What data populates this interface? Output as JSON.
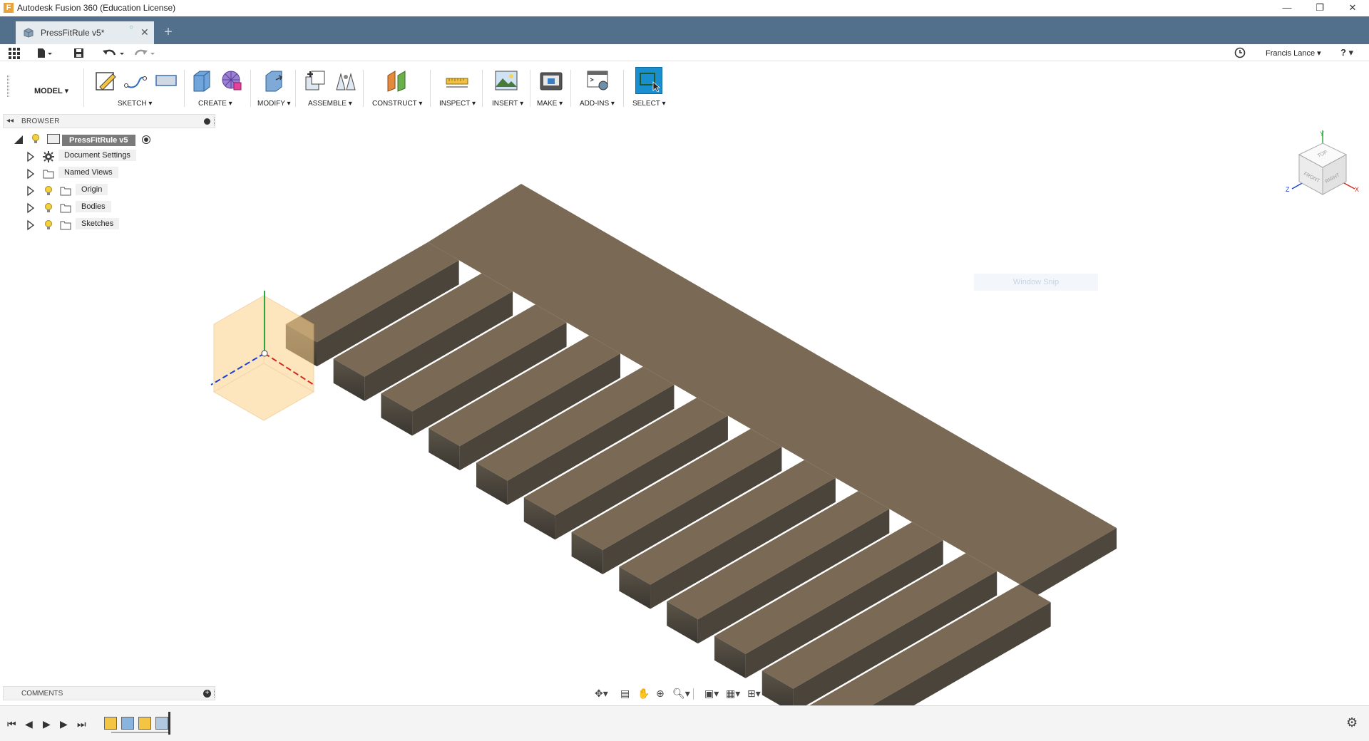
{
  "app": {
    "title": "Autodesk Fusion 360 (Education License)",
    "logo_letter": "F",
    "window_controls": {
      "minimize": "—",
      "restore": "❐",
      "close": "✕"
    }
  },
  "tab": {
    "label": "PressFitRule v5*",
    "close": "✕",
    "new_tab": "+"
  },
  "quickaccess": {
    "user": "Francis Lance ▾",
    "help": "? ▾"
  },
  "toolbar": {
    "workspace": "MODEL ▾",
    "groups": [
      {
        "label": "SKETCH ▾"
      },
      {
        "label": "CREATE ▾"
      },
      {
        "label": "MODIFY ▾"
      },
      {
        "label": "ASSEMBLE ▾"
      },
      {
        "label": "CONSTRUCT ▾"
      },
      {
        "label": "INSPECT ▾"
      },
      {
        "label": "INSERT ▾"
      },
      {
        "label": "MAKE ▾"
      },
      {
        "label": "ADD-INS ▾"
      },
      {
        "label": "SELECT ▾"
      }
    ],
    "accent": "#1a8fd0"
  },
  "browser": {
    "title": "BROWSER",
    "root": "PressFitRule v5",
    "items": [
      {
        "label": "Document Settings",
        "icon": "gear-icon"
      },
      {
        "label": "Named Views",
        "icon": "folder-icon"
      },
      {
        "label": "Origin",
        "icon": "folder-icon"
      },
      {
        "label": "Bodies",
        "icon": "folder-icon"
      },
      {
        "label": "Sketches",
        "icon": "folder-icon"
      }
    ]
  },
  "comments": {
    "title": "COMMENTS"
  },
  "viewport": {
    "tooltip": "Window Snip",
    "viewcube": {
      "top": "TOP",
      "front": "FRONT",
      "right": "RIGHT",
      "axes": {
        "x": "X",
        "y": "Y",
        "z": "Z"
      }
    },
    "model_color": "#7a6a55"
  }
}
